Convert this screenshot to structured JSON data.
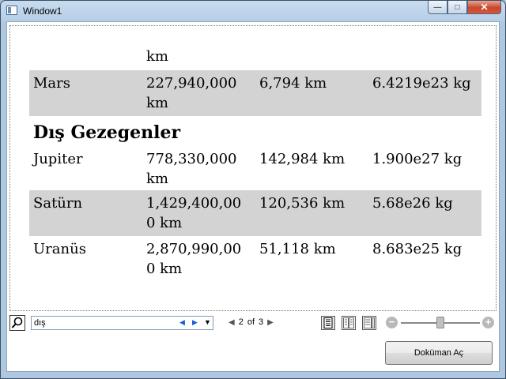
{
  "window": {
    "title": "Window1"
  },
  "document": {
    "partial_top_text": "km",
    "rows_before": [
      {
        "name": "Mars",
        "distance_line1": "227,940,000",
        "distance_line2": "km",
        "diameter": "6,794 km",
        "mass": "6.4219e23 kg"
      }
    ],
    "heading": "Dış Gezegenler",
    "rows": [
      {
        "name": "Jupiter",
        "distance_line1": "778,330,000",
        "distance_line2": "km",
        "diameter": "142,984 km",
        "mass": "1.900e27 kg"
      },
      {
        "name": "Satürn",
        "distance_line1": "1,429,400,00",
        "distance_line2": "0 km",
        "diameter": "120,536 km",
        "mass": "5.68e26 kg"
      },
      {
        "name": "Uranüs",
        "distance_line1": "2,870,990,00",
        "distance_line2": "0 km",
        "diameter": "51,118 km",
        "mass": "8.683e25 kg"
      }
    ]
  },
  "toolbar": {
    "search_value": "dış",
    "page_current": "2",
    "page_of": "of",
    "page_total": "3",
    "zoom_level": 0.5
  },
  "open_button": "Doküman Aç"
}
